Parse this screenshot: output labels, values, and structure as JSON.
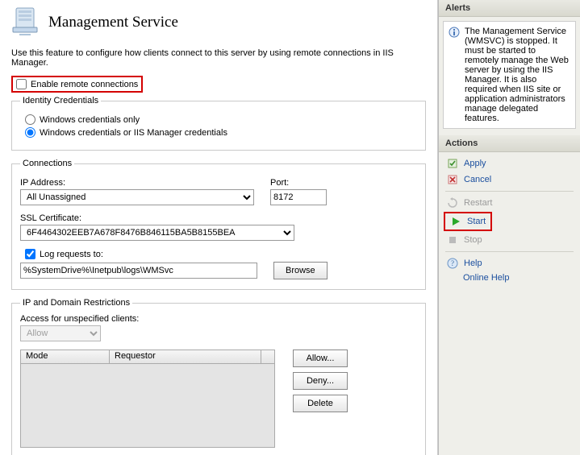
{
  "header": {
    "title": "Management Service",
    "description": "Use this feature to configure how clients connect to this server by using remote connections in IIS Manager."
  },
  "enable_remote": {
    "label": "Enable remote connections",
    "checked": false
  },
  "identity": {
    "legend": "Identity Credentials",
    "opt1": "Windows credentials only",
    "opt2": "Windows credentials or IIS Manager credentials",
    "selected": "opt2"
  },
  "connections": {
    "legend": "Connections",
    "ip_label": "IP Address:",
    "ip_value": "All Unassigned",
    "port_label": "Port:",
    "port_value": "8172",
    "ssl_label": "SSL Certificate:",
    "ssl_value": "6F4464302EEB7A678F8476B846115BA5B8155BEA",
    "log_label": "Log requests to:",
    "log_checked": true,
    "log_value": "%SystemDrive%\\Inetpub\\logs\\WMSvc",
    "browse_label": "Browse"
  },
  "restrictions": {
    "legend": "IP and Domain Restrictions",
    "access_label": "Access for unspecified clients:",
    "access_value": "Allow",
    "col_mode": "Mode",
    "col_requestor": "Requestor",
    "btn_allow": "Allow...",
    "btn_deny": "Deny...",
    "btn_delete": "Delete"
  },
  "alerts": {
    "heading": "Alerts",
    "message": "The Management Service (WMSVC) is stopped. It must be started to remotely manage the Web server by using the IIS Manager. It is also required when IIS site or application administrators manage delegated features."
  },
  "actions": {
    "heading": "Actions",
    "apply": "Apply",
    "cancel": "Cancel",
    "restart": "Restart",
    "start": "Start",
    "stop": "Stop",
    "help": "Help",
    "online_help": "Online Help"
  }
}
